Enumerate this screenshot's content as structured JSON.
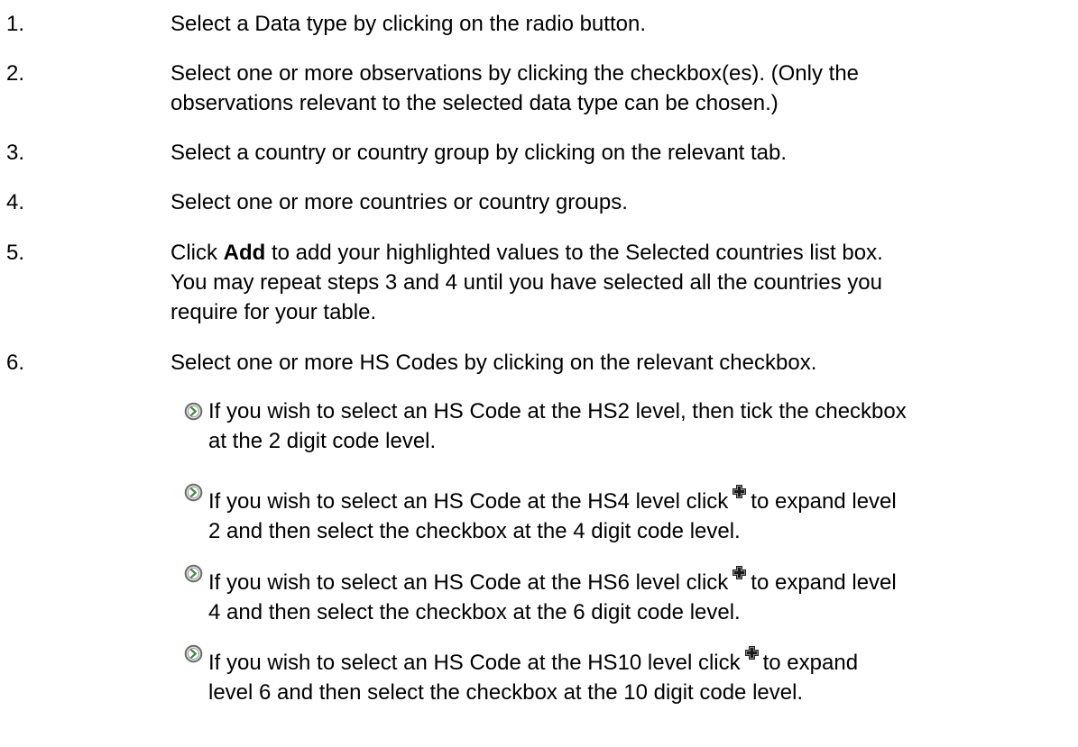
{
  "steps": [
    {
      "num": "1.",
      "lines": [
        "Select a Data type by clicking on the radio button."
      ]
    },
    {
      "num": "2.",
      "lines": [
        "Select one or more observations by clicking the checkbox(es). (Only the",
        "observations relevant to the selected data type can be chosen.)"
      ]
    },
    {
      "num": "3.",
      "lines": [
        "Select a country or country group by clicking on the relevant tab."
      ]
    },
    {
      "num": "4.",
      "lines": [
        "Select one or more countries or country groups."
      ]
    },
    {
      "num": "5.",
      "lines": [
        "Click",
        "Add",
        "to add your highlighted values to the Selected countries list box.",
        "You may repeat steps 3 and 4 until you have selected all the countries you",
        "require for your table."
      ]
    },
    {
      "num": "6.",
      "lines": [
        "Select one or more HS Codes by clicking on the relevant checkbox."
      ]
    }
  ],
  "bullets": [
    {
      "icon": "circle-arrow-right-icon",
      "lines": [
        "If you wish to select an HS Code at the HS2 level, then tick the checkbox",
        "at the 2 digit code level."
      ]
    },
    {
      "icon": "circle-arrow-right-icon",
      "before_icon": "If you wish to select an HS Code at the HS4 level click",
      "after_icon": "to expand level",
      "line2": "2 and then select the checkbox at the 4 digit code level."
    },
    {
      "icon": "circle-arrow-right-icon",
      "before_icon": "If you wish to select an HS Code at the HS6 level click",
      "after_icon": "to expand level",
      "line2": "4 and then select the checkbox at the 6 digit code level."
    },
    {
      "icon": "circle-arrow-right-icon",
      "before_icon": "If you wish to select an HS Code at the HS10 level click",
      "after_icon": "to expand",
      "line2": "level 6 and then select the checkbox at the 10 digit code level."
    }
  ],
  "icons": {
    "bullet": "circle-arrow-right-icon",
    "expand": "expand-plus-icon"
  },
  "colors": {
    "text": "#000000",
    "bullet_ring": "#6a6a6a",
    "bullet_fill": "#e8e8e8",
    "bullet_arrow": "#3d8a3d"
  }
}
